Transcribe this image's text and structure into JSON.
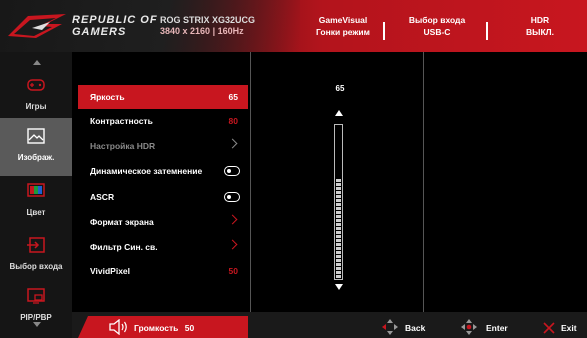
{
  "header": {
    "brand_line1": "REPUBLIC OF",
    "brand_line2": "GAMERS",
    "model": "ROG STRIX XG32UCG",
    "resolution": "3840 x 2160",
    "refresh": "160Hz",
    "items": [
      {
        "line1": "GameVisual",
        "line2": "Гонки режим"
      },
      {
        "line1": "Выбор входа",
        "line2": "USB-C"
      },
      {
        "line1": "HDR",
        "line2": "ВЫКЛ."
      }
    ]
  },
  "nav": {
    "items": [
      {
        "label": "Игры",
        "icon": "gamepad-icon"
      },
      {
        "label": "Изображ.",
        "icon": "image-icon",
        "active": true
      },
      {
        "label": "Цвет",
        "icon": "color-icon"
      },
      {
        "label": "Выбор входа",
        "icon": "input-icon"
      },
      {
        "label": "PIP/PBP",
        "icon": "pip-icon"
      }
    ]
  },
  "menu": {
    "items": [
      {
        "label": "Яркость",
        "value": "65",
        "type": "value",
        "selected": true
      },
      {
        "label": "Контрастность",
        "value": "80",
        "type": "value"
      },
      {
        "label": "Настройка HDR",
        "type": "submenu",
        "disabled": true
      },
      {
        "label": "Динамическое затемнение",
        "type": "toggle"
      },
      {
        "label": "ASCR",
        "type": "toggle"
      },
      {
        "label": "Формат экрана",
        "type": "submenu"
      },
      {
        "label": "Фильтр Син. св.",
        "type": "submenu"
      },
      {
        "label": "VividPixel",
        "value": "50",
        "type": "value"
      }
    ]
  },
  "slider": {
    "value": "65",
    "level": 0.65
  },
  "footer": {
    "volume_label": "Громкость",
    "volume_value": "50",
    "back_label": "Back",
    "enter_label": "Enter",
    "exit_label": "Exit"
  },
  "colors": {
    "accent": "#c8161f",
    "active_nav": "#5a5a5a"
  }
}
